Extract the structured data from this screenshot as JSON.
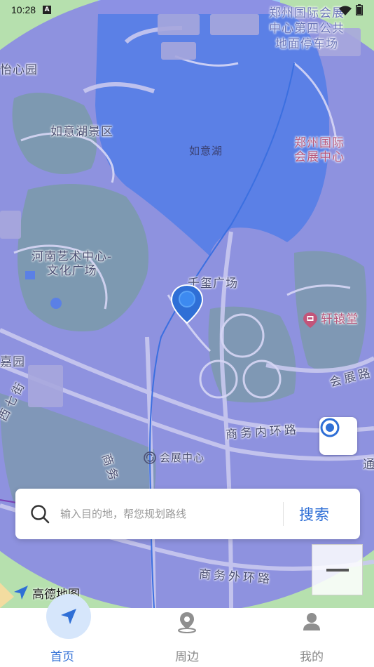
{
  "status_bar": {
    "time": "10:28",
    "notification_badge": "A"
  },
  "map": {
    "labels": {
      "zhengzhou_parking": "郑州国际会展\n中心第四公共\n地面停车场",
      "yixin_garden": "怡心园",
      "ruyi_lake_scenic": "如意湖景区",
      "ruyi_lake": "如意湖",
      "zhengzhou_expo": "郑州国际\n会展中心",
      "henan_art_center": "河南艺术中心-\n文化广场",
      "qianxi_square": "千玺广场",
      "xuanyuan_hall": "轩辕堂",
      "jia_garden": "嘉园",
      "huizhan_road": "会展路",
      "xiqi_street": "西七街",
      "shangwu_inner_ring": "商务内环路",
      "expo_center_station": "会展中心",
      "shangwu_road": "商务",
      "shangwu_outer_ring": "商务外环路",
      "tong": "通"
    },
    "logo_text": "高德地图",
    "accent_color": "#2f6fd6",
    "overlay_color": "#8a8ae6"
  },
  "search": {
    "placeholder": "输入目的地，帮您规划路线",
    "button_label": "搜索"
  },
  "nav": {
    "home_label": "首页",
    "nearby_label": "周边",
    "mine_label": "我的"
  }
}
